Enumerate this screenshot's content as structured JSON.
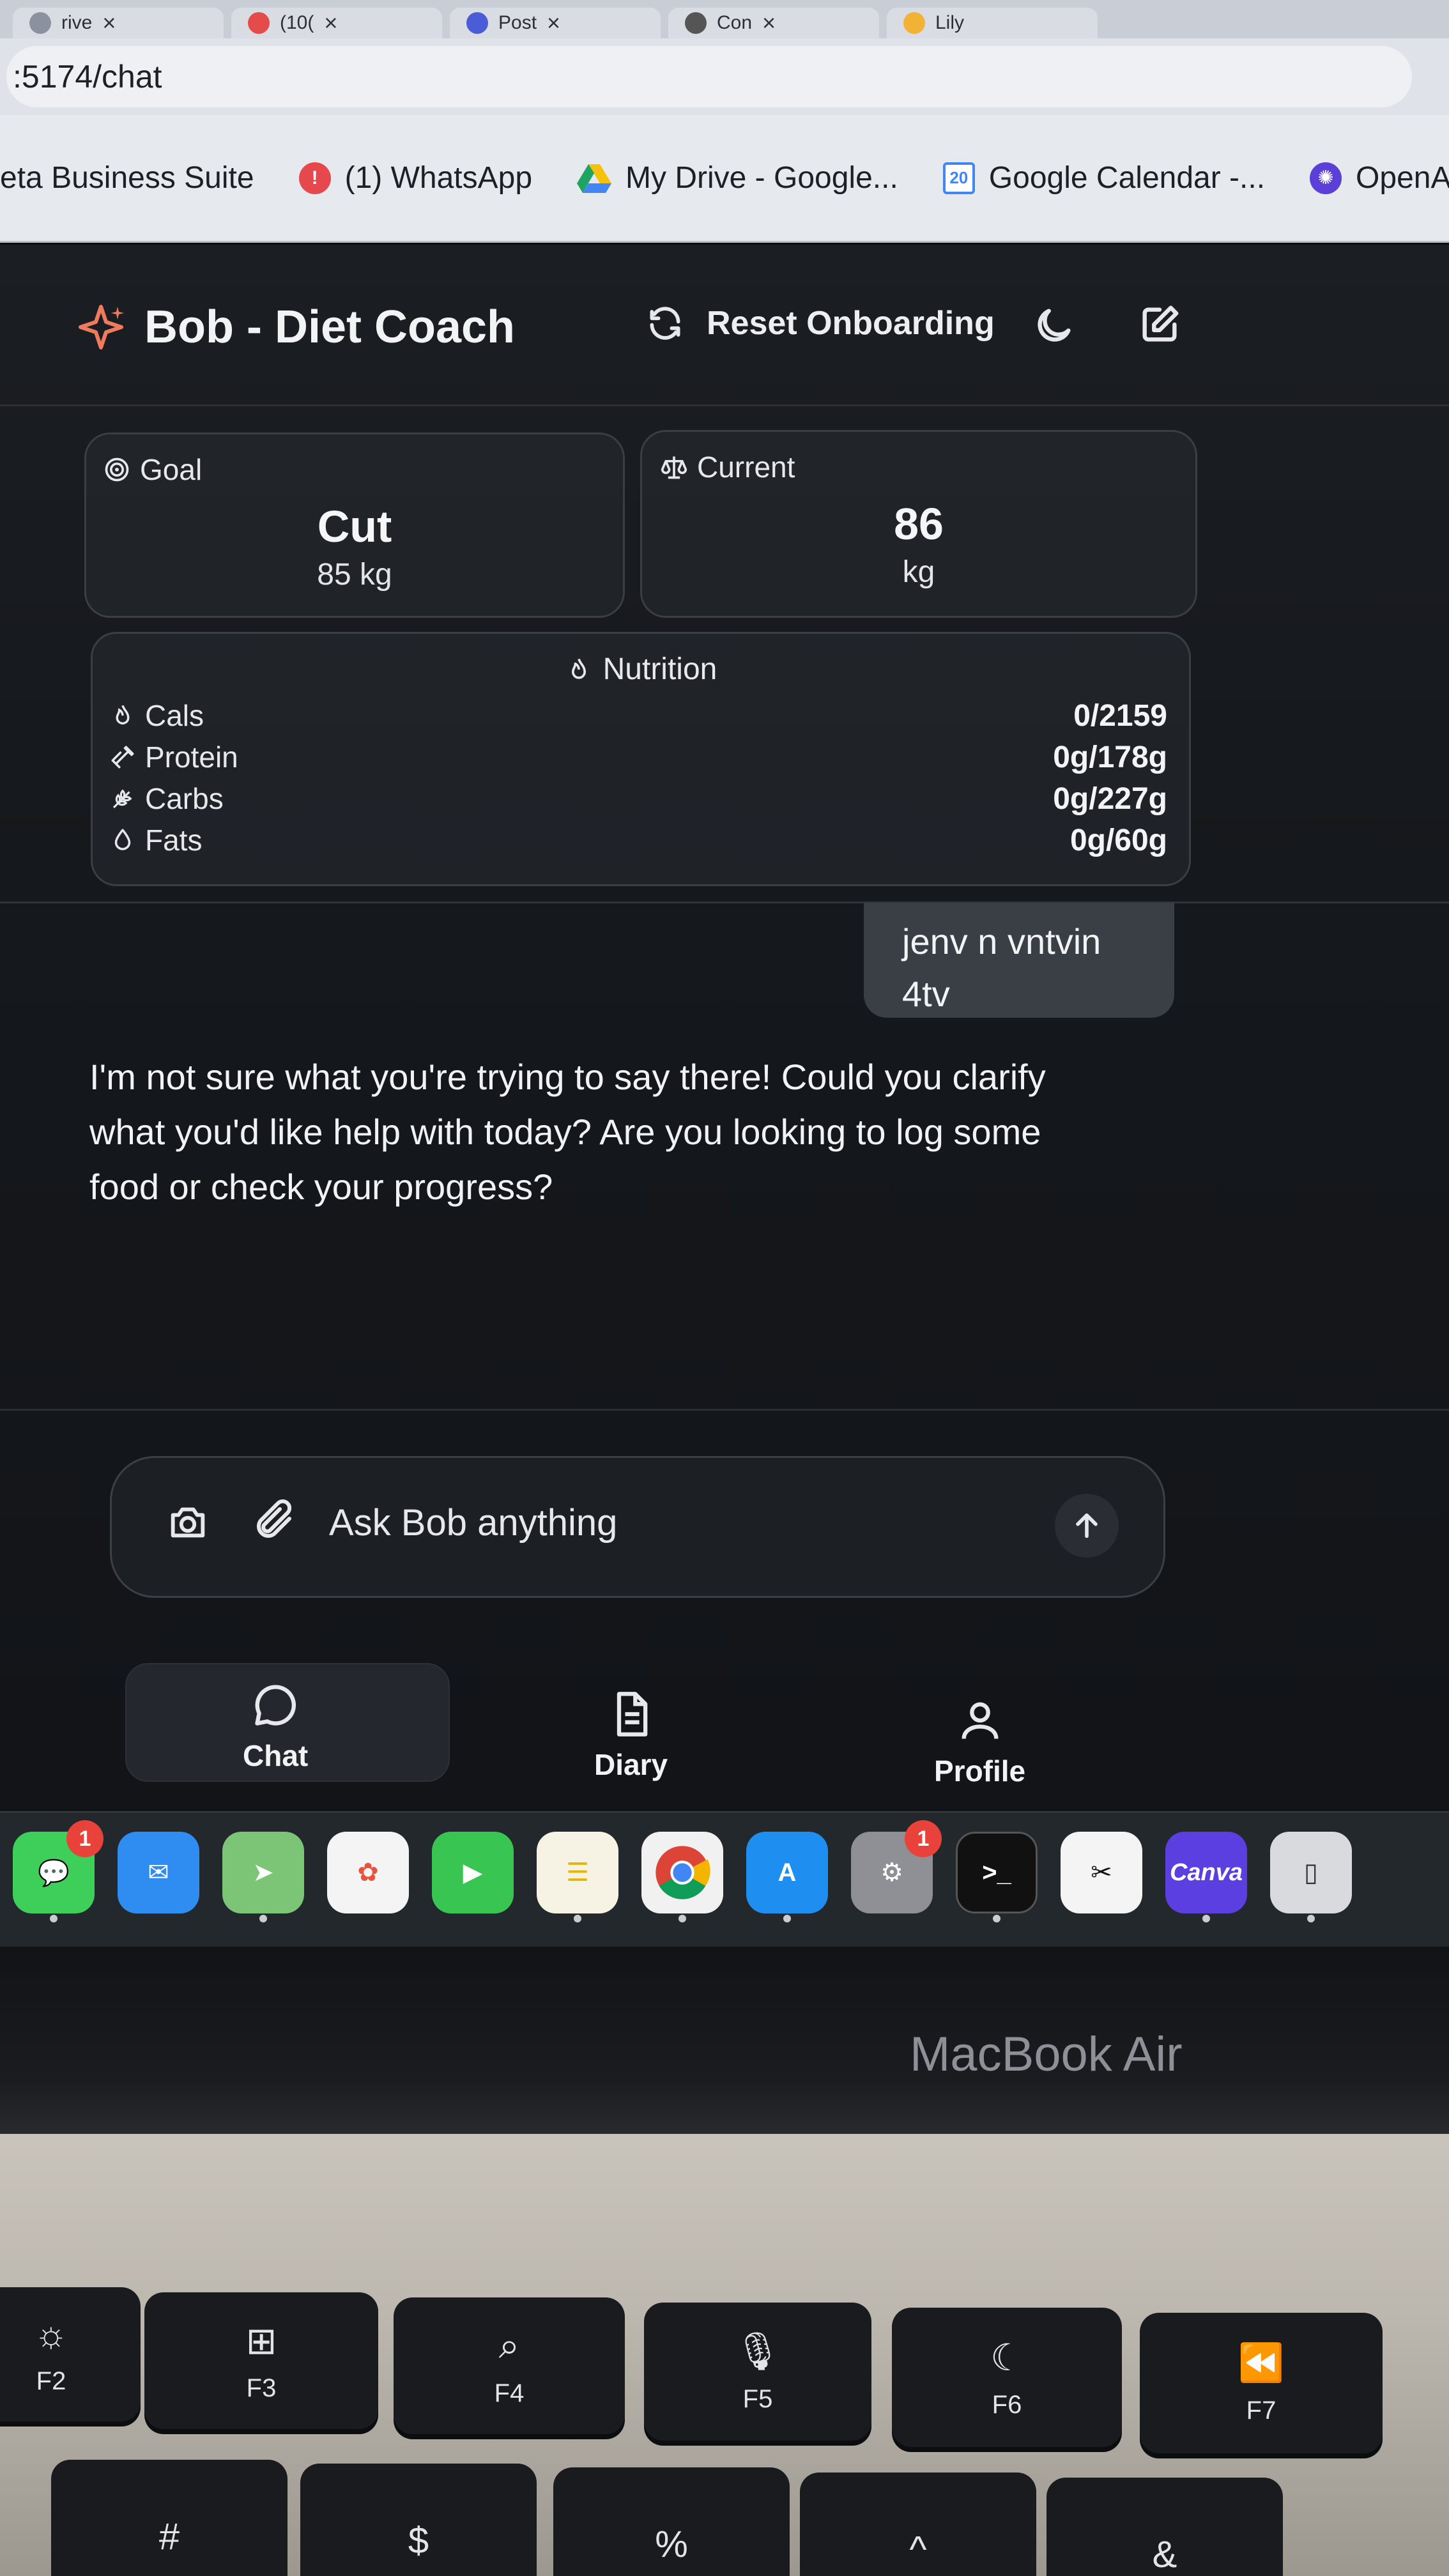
{
  "browser": {
    "tabs": [
      {
        "label": "rive"
      },
      {
        "label": "(10("
      },
      {
        "label": "Post"
      },
      {
        "label": "Con"
      },
      {
        "label": "Lily"
      }
    ],
    "url": ":5174/chat",
    "bookmarks": [
      {
        "label": "eta Business Suite"
      },
      {
        "label": "(1) WhatsApp"
      },
      {
        "label": "My Drive - Google..."
      },
      {
        "label": "Google Calendar -..."
      },
      {
        "label": "OpenAI P"
      }
    ],
    "calendar_icon_day": "20"
  },
  "app": {
    "title": "Bob - Diet Coach",
    "reset_label": "Reset Onboarding",
    "accent_color": "#f07a5e",
    "goal": {
      "label": "Goal",
      "value": "Cut",
      "sub": "85 kg"
    },
    "current": {
      "label": "Current",
      "value": "86",
      "sub": "kg"
    },
    "nutrition": {
      "title": "Nutrition",
      "rows": [
        {
          "name": "Cals",
          "value": "0/2159"
        },
        {
          "name": "Protein",
          "value": "0g/178g"
        },
        {
          "name": "Carbs",
          "value": "0g/227g"
        },
        {
          "name": "Fats",
          "value": "0g/60g"
        }
      ]
    },
    "messages": {
      "user": "jenv n vntvin 4tv",
      "assistant": "I'm not sure what you're trying to say there! Could you clarify what you'd like help with today? Are you looking to log some food or check your progress?"
    },
    "composer": {
      "placeholder": "Ask Bob anything"
    },
    "nav": [
      {
        "label": "Chat",
        "active": true
      },
      {
        "label": "Diary",
        "active": false
      },
      {
        "label": "Profile",
        "active": false
      }
    ]
  },
  "dock": {
    "apps": [
      {
        "name": "Messages",
        "badge": "1"
      },
      {
        "name": "Mail"
      },
      {
        "name": "Maps"
      },
      {
        "name": "Photos"
      },
      {
        "name": "FaceTime"
      },
      {
        "name": "Notes"
      },
      {
        "name": "Chrome"
      },
      {
        "name": "App Store"
      },
      {
        "name": "System Settings",
        "badge": "1"
      },
      {
        "name": "Terminal"
      },
      {
        "name": "CapCut"
      },
      {
        "name": "Canva",
        "text": "Canva"
      },
      {
        "name": "iPhone Mirroring"
      }
    ]
  },
  "laptop": {
    "label": "MacBook Air",
    "fkeys": [
      {
        "label": "F2",
        "icon": "☼"
      },
      {
        "label": "F3",
        "icon": "⊞"
      },
      {
        "label": "F4",
        "icon": "⌕"
      },
      {
        "label": "F5",
        "icon": "🎙"
      },
      {
        "label": "F6",
        "icon": "☾"
      },
      {
        "label": "F7",
        "icon": "⏪"
      }
    ],
    "numkeys": [
      "#",
      "$",
      "%",
      "^",
      "&"
    ]
  }
}
